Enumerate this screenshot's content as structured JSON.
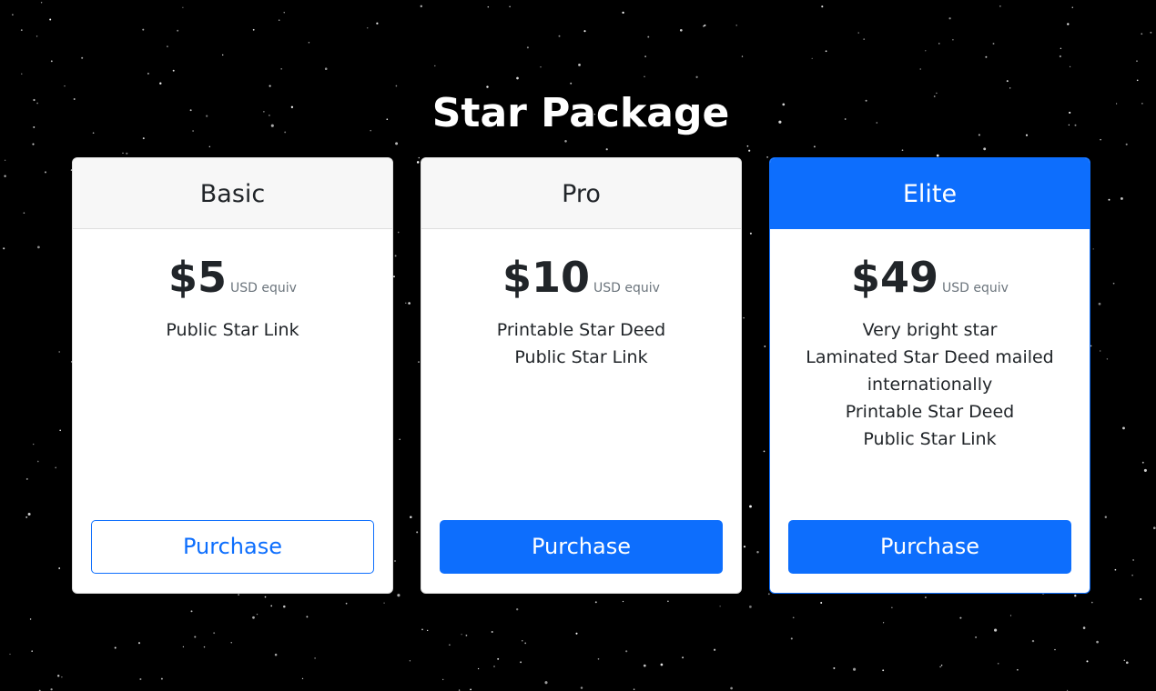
{
  "page": {
    "title": "Star Package"
  },
  "plans": [
    {
      "name": "Basic",
      "price": "$5",
      "unit": "USD equiv",
      "features": [
        "Public Star Link"
      ],
      "button": "Purchase"
    },
    {
      "name": "Pro",
      "price": "$10",
      "unit": "USD equiv",
      "features": [
        "Printable Star Deed",
        "Public Star Link"
      ],
      "button": "Purchase"
    },
    {
      "name": "Elite",
      "price": "$49",
      "unit": "USD equiv",
      "features": [
        "Very bright star",
        "Laminated Star Deed mailed internationally",
        "Printable Star Deed",
        "Public Star Link"
      ],
      "button": "Purchase"
    }
  ],
  "colors": {
    "background": "#000000",
    "accent": "#0d6efd",
    "card": "#ffffff",
    "header": "#f7f7f7"
  }
}
